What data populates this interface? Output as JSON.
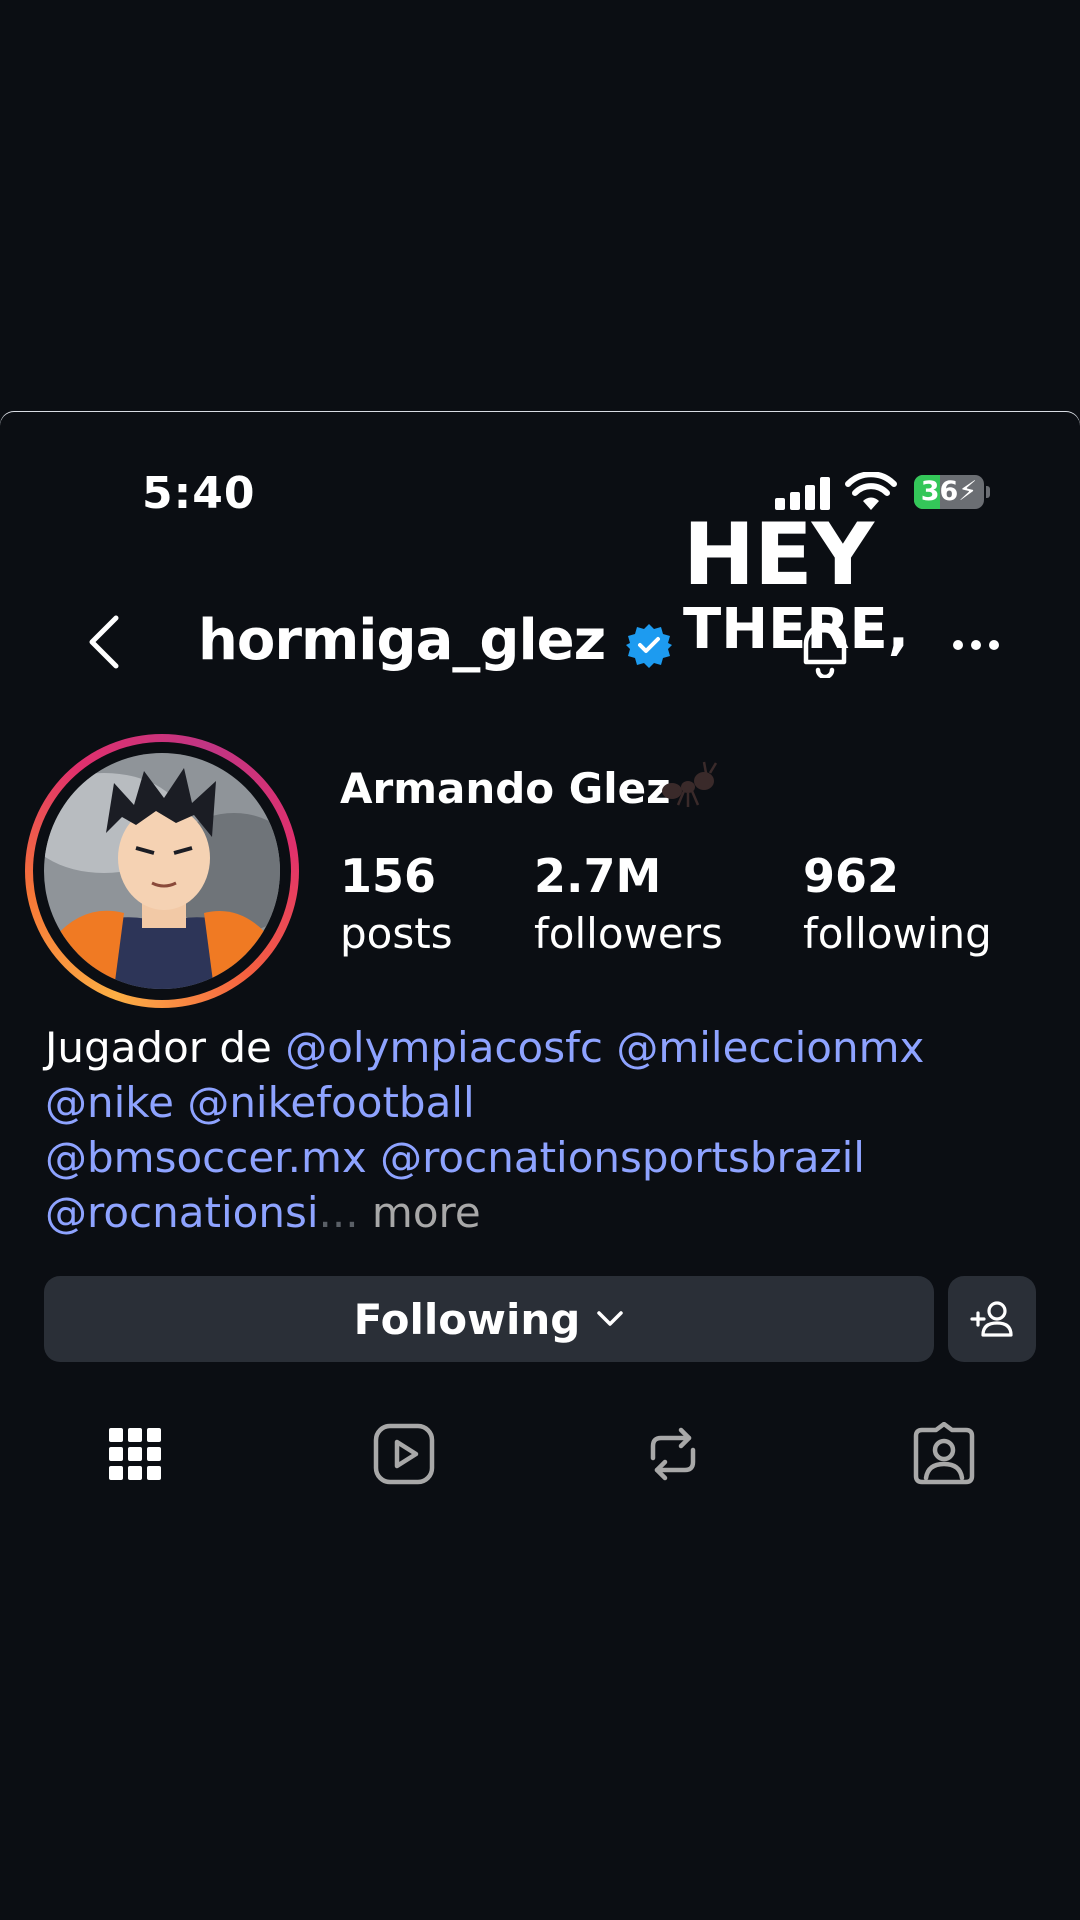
{
  "status_bar": {
    "time": "5:40",
    "battery": "36"
  },
  "overlay": {
    "line1": "HEY",
    "line2": "THERE,"
  },
  "header": {
    "username": "hormiga_glez"
  },
  "profile": {
    "full_name": "Armando Glez",
    "name_emoji": "ant",
    "stats": [
      {
        "value": "156",
        "label": "posts"
      },
      {
        "value": "2.7M",
        "label": "followers"
      },
      {
        "value": "962",
        "label": "following"
      }
    ],
    "bio": {
      "prefix": "Jugador de ",
      "mention1": "@olympiacosfc",
      "mention2": "@mileccionmx",
      "mention3": "@nike",
      "mention4": "@nikefootball",
      "mention5": "@bmsoccer.mx",
      "mention6": "@rocnationsportsbrazil",
      "mention7": "@rocnationsi",
      "ellipsis": "...",
      "more": "more"
    }
  },
  "actions": {
    "following_label": "Following"
  },
  "tabs": [
    "grid-icon",
    "reels-icon",
    "reposts-icon",
    "tagged-icon"
  ],
  "colors": {
    "background": "#0b0e13",
    "mention": "#8ea3ff",
    "button": "#2a2f37",
    "verified": "#1d9bf0"
  }
}
